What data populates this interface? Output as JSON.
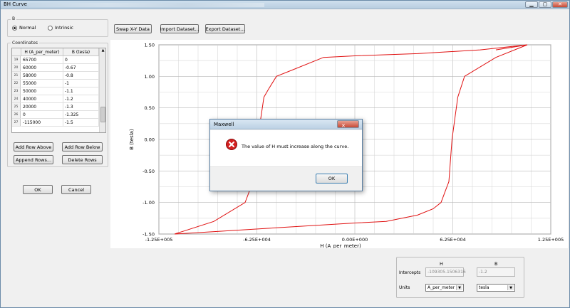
{
  "window": {
    "title": "BH Curve"
  },
  "b_group": {
    "label": "B",
    "normal_label": "Normal",
    "intrinsic_label": "Intrinsic",
    "selected": "normal"
  },
  "toolbar": {
    "swap_label": "Swap X-Y Data",
    "import_label": "Import Dataset...",
    "export_label": "Export Dataset..."
  },
  "coordinates": {
    "label": "Coordinates",
    "col_h": "H (A_per_meter)",
    "col_b": "B (tesla)",
    "rows": [
      {
        "n": "19",
        "h": "65700",
        "b": "0"
      },
      {
        "n": "20",
        "h": "60000",
        "b": "-0.67"
      },
      {
        "n": "21",
        "h": "58000",
        "b": "-0.8"
      },
      {
        "n": "22",
        "h": "55000",
        "b": "-1"
      },
      {
        "n": "23",
        "h": "50000",
        "b": "-1.1"
      },
      {
        "n": "24",
        "h": "40000",
        "b": "-1.2"
      },
      {
        "n": "25",
        "h": "20000",
        "b": "-1.3"
      },
      {
        "n": "26",
        "h": "0",
        "b": "-1.325"
      },
      {
        "n": "27",
        "h": "-115000",
        "b": "-1.5"
      }
    ],
    "add_above_label": "Add Row Above",
    "add_below_label": "Add Row Below",
    "append_label": "Append Rows...",
    "delete_label": "Delete Rows"
  },
  "ok_label": "OK",
  "cancel_label": "Cancel",
  "chart_data": {
    "type": "line",
    "xlabel": "H (A_per_meter)",
    "ylabel": "B (tesla)",
    "xlim": [
      -125000,
      125000
    ],
    "ylim": [
      -1.5,
      1.5
    ],
    "x_ticks": [
      "-1.25E+005",
      "-6.25E+004",
      "0.00E+000",
      "6.25E+004",
      "1.25E+005"
    ],
    "y_ticks": [
      "1.50",
      "1.00",
      "0.50",
      "0.00",
      "-0.50",
      "-1.00",
      "-1.50"
    ],
    "grid": true,
    "series": [
      {
        "color": "#e01010",
        "points": [
          [
            -115000,
            -1.5
          ],
          [
            -90000,
            -1.3
          ],
          [
            -70000,
            -1.0
          ],
          [
            -65000,
            -0.67
          ],
          [
            -62000,
            0
          ],
          [
            -58000,
            0.67
          ],
          [
            -55000,
            0.8
          ],
          [
            -50000,
            1.0
          ],
          [
            -40000,
            1.1
          ],
          [
            -20000,
            1.3
          ],
          [
            0,
            1.325
          ],
          [
            40000,
            1.36
          ],
          [
            80000,
            1.42
          ],
          [
            110000,
            1.5
          ],
          [
            90000,
            1.3
          ],
          [
            70000,
            1.0
          ],
          [
            65700,
            0.67
          ],
          [
            62000,
            0
          ],
          [
            60000,
            -0.67
          ],
          [
            58000,
            -0.8
          ],
          [
            55000,
            -1.0
          ],
          [
            50000,
            -1.1
          ],
          [
            40000,
            -1.2
          ],
          [
            20000,
            -1.3
          ],
          [
            0,
            -1.325
          ],
          [
            -115000,
            -1.5
          ]
        ]
      },
      {
        "color": "#e01010",
        "points": [
          [
            90000,
            1.42
          ],
          [
            110000,
            1.5
          ]
        ]
      }
    ]
  },
  "dialog": {
    "title": "Maxwell",
    "message": "The value of H must increase along the curve.",
    "ok_label": "OK"
  },
  "intercepts": {
    "col_h": "H",
    "col_b": "B",
    "intercepts_label": "Intercepts",
    "h_value": "-109305.1506316",
    "b_value": "-1.2",
    "units_label": "Units",
    "h_unit": "A_per_meter",
    "b_unit": "tesla"
  }
}
